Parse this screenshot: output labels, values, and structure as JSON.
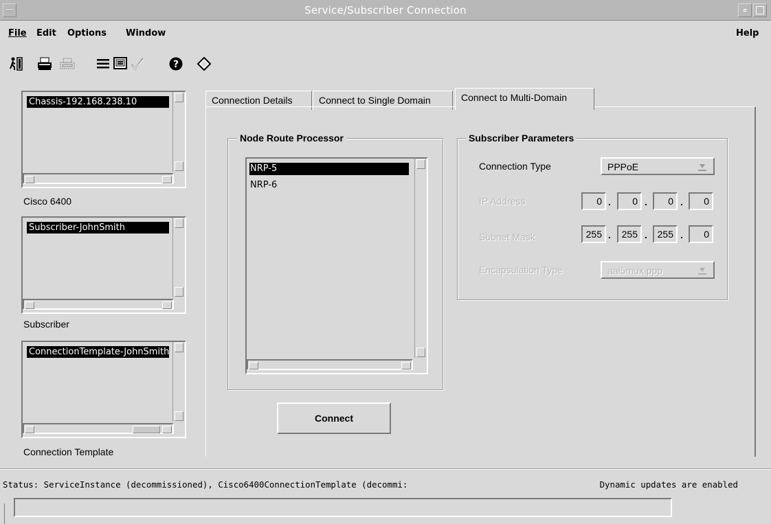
{
  "window": {
    "title": "Service/Subscriber Connection"
  },
  "menu": {
    "file": "File",
    "edit": "Edit",
    "options": "Options",
    "window": "Window",
    "help": "Help"
  },
  "toolbar": {
    "icons": [
      "exit-icon",
      "print-icon",
      "print-preview-icon",
      "list-icon",
      "monitor-icon",
      "checkmark-icon",
      "help-icon",
      "diamond-icon"
    ]
  },
  "lists": {
    "chassis": {
      "selected": "Chassis-192.168.238.10",
      "caption": "Cisco 6400"
    },
    "subscriber": {
      "selected": "Subscriber-JohnSmith",
      "caption": "Subscriber"
    },
    "template": {
      "selected": "ConnectionTemplate-JohnSmith",
      "caption": "Connection Template"
    }
  },
  "tabs": [
    {
      "label": "Connection Details"
    },
    {
      "label": "Connect to Single Domain"
    },
    {
      "label": "Connect to Multi-Domain"
    }
  ],
  "nrp": {
    "group_label": "Node Route Processor",
    "items": [
      "NRP-5",
      "NRP-6"
    ],
    "selected": "NRP-5"
  },
  "subscriber_params": {
    "group_label": "Subscriber Parameters",
    "connection_type": {
      "label": "Connection Type",
      "value": "PPPoE"
    },
    "ip_address": {
      "label": "IP Address",
      "octets": [
        "0",
        "0",
        "0",
        "0"
      ]
    },
    "subnet_mask": {
      "label": "Subnet Mask",
      "octets": [
        "255",
        "255",
        "255",
        "0"
      ]
    },
    "encapsulation_type": {
      "label": "Encapsulation Type",
      "value": "aal5mux ppp"
    }
  },
  "connect_button": "Connect",
  "status": {
    "text": "Status: ServiceInstance (decommissioned), Cisco6400ConnectionTemplate (decommi:",
    "dynamic": "Dynamic updates are enabled"
  }
}
